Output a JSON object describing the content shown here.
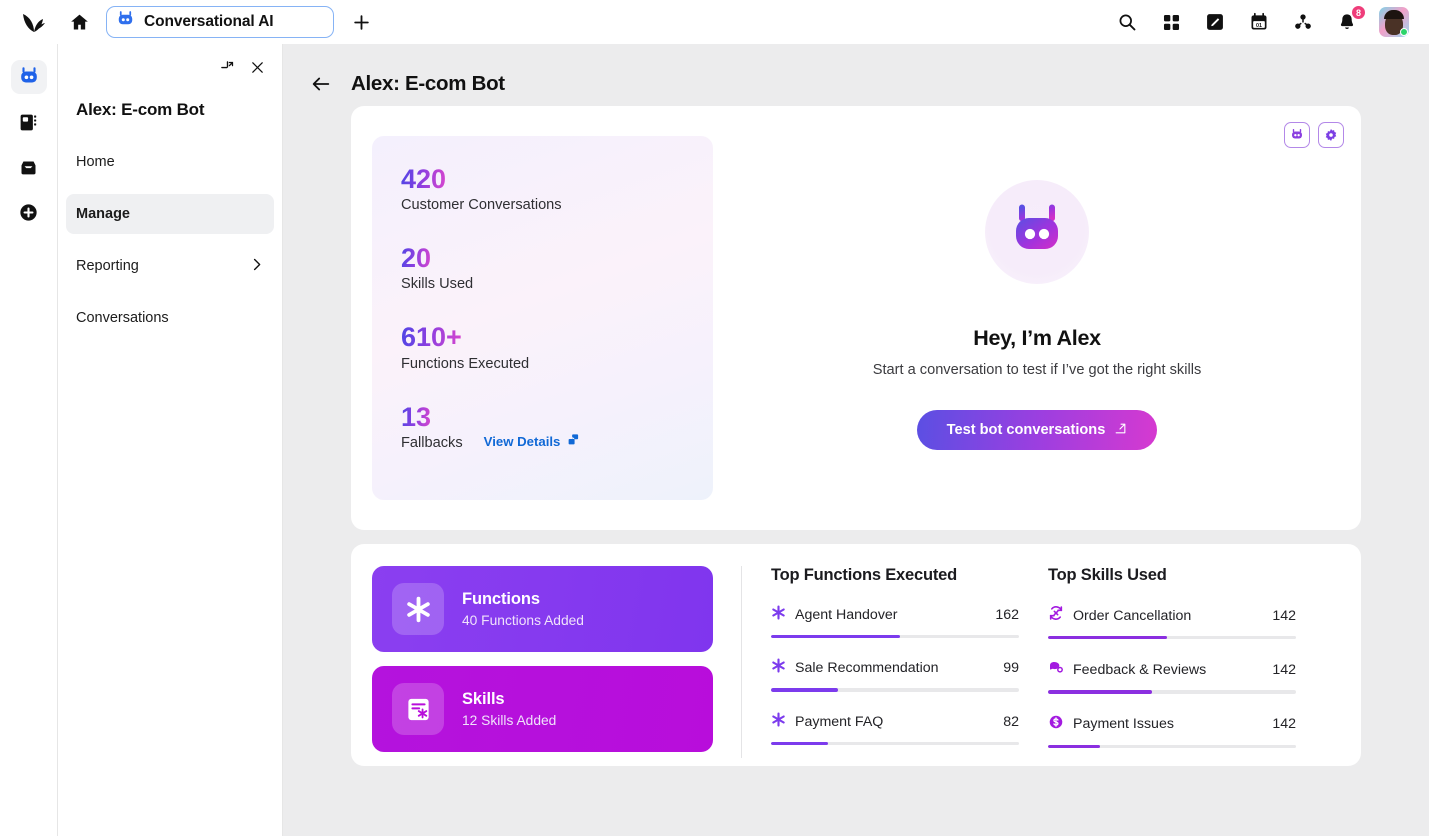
{
  "topbar": {
    "logo_icon": "sprout-logo-icon",
    "home_icon": "home-icon",
    "tab": {
      "label": "Conversational AI",
      "icon": "bot-icon"
    },
    "new_tab_icon": "plus-icon",
    "actions": [
      {
        "name": "search",
        "icon": "search-icon"
      },
      {
        "name": "apps",
        "icon": "grid-apps-icon"
      },
      {
        "name": "compose",
        "icon": "compose-pencil-icon"
      },
      {
        "name": "calendar",
        "icon": "calendar-icon",
        "label": "01"
      },
      {
        "name": "network",
        "icon": "share-network-icon"
      },
      {
        "name": "notifications",
        "icon": "bell-icon",
        "badge": "8"
      }
    ],
    "avatar_name": "user-avatar"
  },
  "rail": {
    "items": [
      {
        "name": "bot",
        "icon": "bot-icon",
        "active": true
      },
      {
        "name": "library",
        "icon": "book-icon",
        "active": false
      },
      {
        "name": "inbox",
        "icon": "inbox-icon",
        "active": false
      },
      {
        "name": "add",
        "icon": "plus-circle-icon",
        "active": false
      }
    ]
  },
  "panel": {
    "collapse_icon": "collapse-icon",
    "close_icon": "close-icon",
    "title": "Alex: E-com Bot",
    "nav": [
      {
        "label": "Home",
        "active": false,
        "chevron": false
      },
      {
        "label": "Manage",
        "active": true,
        "chevron": false
      },
      {
        "label": "Reporting",
        "active": false,
        "chevron": true
      },
      {
        "label": "Conversations",
        "active": false,
        "chevron": false
      }
    ]
  },
  "main": {
    "back_icon": "back-arrow-icon",
    "title": "Alex: E-com Bot",
    "card_actions": [
      {
        "name": "bot-preview",
        "icon": "bot-icon"
      },
      {
        "name": "settings",
        "icon": "gear-icon"
      }
    ],
    "stats": [
      {
        "value": "420",
        "label": "Customer Conversations"
      },
      {
        "value": "20",
        "label": "Skills Used"
      },
      {
        "value": "610+",
        "label": "Functions Executed"
      },
      {
        "value": "13",
        "label": "Fallbacks",
        "link": "View Details",
        "link_icon": "external-link-icon"
      }
    ],
    "hero": {
      "avatar_icon": "bot-avatar-icon",
      "title": "Hey, I’m Alex",
      "subtitle": "Start a conversation to test if I’ve got the right skills",
      "button": "Test bot conversations",
      "button_icon": "external-link-icon"
    },
    "tiles": [
      {
        "title": "Functions",
        "subtitle": "40 Functions Added",
        "icon": "asterisk-icon",
        "color": "#8035ee"
      },
      {
        "title": "Skills",
        "subtitle": "12 Skills Added",
        "icon": "skill-card-icon",
        "color": "#b80ddb"
      }
    ],
    "top_functions": {
      "title": "Top Functions Executed",
      "rows": [
        {
          "label": "Agent Handover",
          "value": "162",
          "pct": 52,
          "icon": "asterisk-icon"
        },
        {
          "label": "Sale Recommendation",
          "value": "99",
          "pct": 27,
          "icon": "asterisk-icon"
        },
        {
          "label": "Payment FAQ",
          "value": "82",
          "pct": 23,
          "icon": "asterisk-icon"
        }
      ]
    },
    "top_skills": {
      "title": "Top Skills Used",
      "rows": [
        {
          "label": "Order Cancellation",
          "value": "142",
          "pct": 48,
          "icon": "cancel-cycle-icon"
        },
        {
          "label": "Feedback & Reviews",
          "value": "142",
          "pct": 42,
          "icon": "feedback-bubble-icon"
        },
        {
          "label": "Payment Issues",
          "value": "142",
          "pct": 21,
          "icon": "dollar-circle-icon"
        }
      ]
    }
  },
  "colors": {
    "accent_purple": "#8b2fe0",
    "accent_blue": "#1169d6",
    "gradient_start": "#4f46e5",
    "gradient_end": "#d946ce",
    "badge_pink": "#ef3d7a",
    "canvas_gray": "#ececed"
  }
}
